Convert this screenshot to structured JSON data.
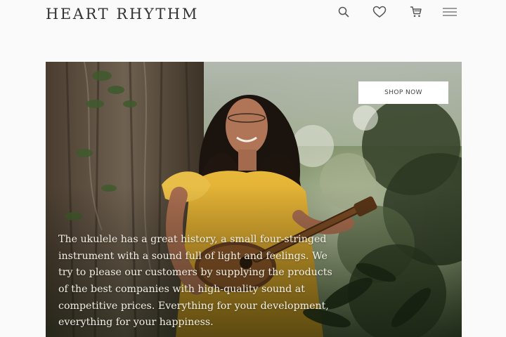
{
  "header": {
    "brand": "HEART RHYTHM",
    "icons": {
      "search": "search-icon",
      "wishlist": "heart-icon",
      "cart": "cart-icon",
      "menu": "hamburger-menu-icon"
    }
  },
  "hero": {
    "cta_label": "SHOP NOW",
    "description": "The ukulele has a great history, a small four-stringed instrument with a sound full of light and feelings. We try to please our customers by supplying the products of the best companies with high-quality sound at competitive prices. Everything for your development, everything for your happiness.",
    "image": "woman-playing-ukulele-in-forest"
  },
  "colors": {
    "background": "#fafafa",
    "text": "#333333",
    "button_bg": "#ffffff"
  }
}
